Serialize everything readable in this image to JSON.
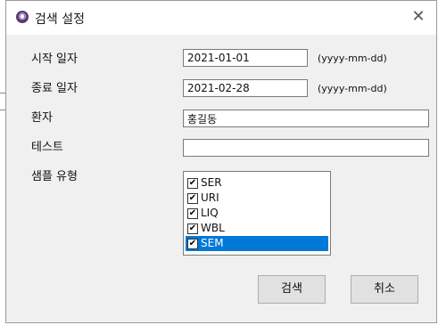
{
  "dialog": {
    "title": "검색 설정",
    "close_symbol": "✕",
    "app_icon_symbol": "◉"
  },
  "fields": {
    "start_date": {
      "label": "시작 일자",
      "value": "2021-01-01",
      "hint": "(yyyy-mm-dd)"
    },
    "end_date": {
      "label": "종료 일자",
      "value": "2021-02-28",
      "hint": "(yyyy-mm-dd)"
    },
    "patient": {
      "label": "환자",
      "value": "홍길동"
    },
    "test": {
      "label": "테스트",
      "value": ""
    },
    "sample_type": {
      "label": "샘플 유형",
      "items": [
        {
          "label": "SER",
          "checked": true,
          "selected": false
        },
        {
          "label": "URI",
          "checked": true,
          "selected": false
        },
        {
          "label": "LIQ",
          "checked": true,
          "selected": false
        },
        {
          "label": "WBL",
          "checked": true,
          "selected": false
        },
        {
          "label": "SEM",
          "checked": true,
          "selected": true
        }
      ]
    }
  },
  "buttons": {
    "search": "검색",
    "cancel": "취소"
  },
  "colors": {
    "selection": "#0078d7",
    "dialog_bg": "#f0f0f0"
  }
}
